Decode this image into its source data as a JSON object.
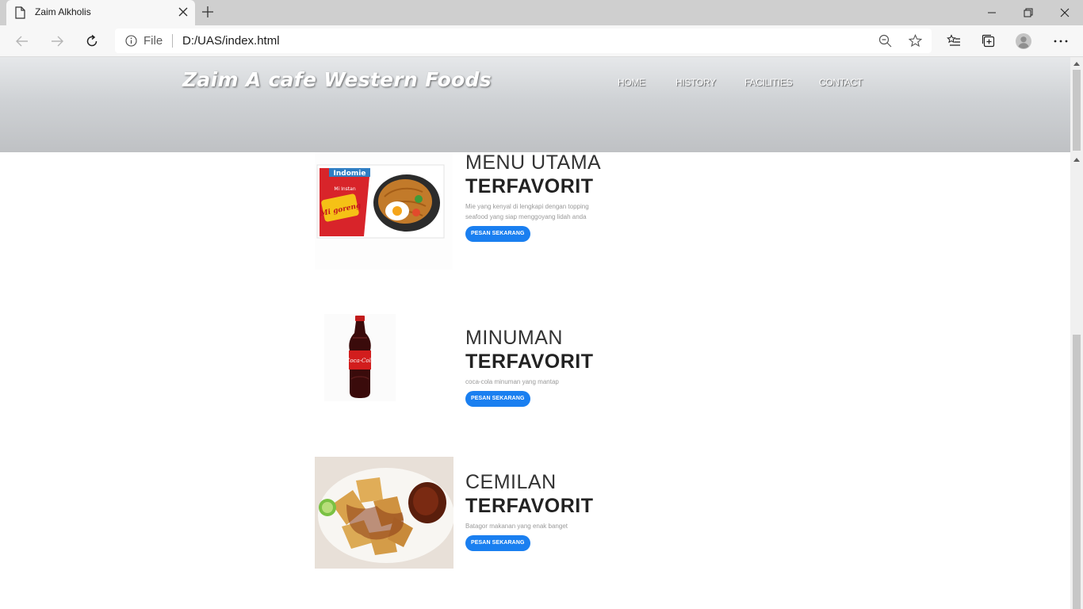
{
  "browser": {
    "tab_title": "Zaim Alkholis",
    "address_scheme": "File",
    "url": "D:/UAS/index.html"
  },
  "site": {
    "title": "Zaim A cafe Western Foods",
    "nav": [
      "HOME",
      "HISTORY",
      "FACILITIES",
      "CONTACT"
    ]
  },
  "menu": [
    {
      "category": "MENU UTAMA",
      "highlight": "TERFAVORIT",
      "description": "Mie yang kenyal di lengkapi dengan topping seafood yang siap menggoyang lidah anda",
      "button": "PESAN SEKARANG",
      "image": "indomie-mi-goreng-image",
      "packet_brand": "Indomie",
      "packet_sub": "Mi Instan",
      "packet_name": "Mi goreng"
    },
    {
      "category": "MINUMAN",
      "highlight": "TERFAVORIT",
      "description": "coca-cola minuman yang mantap",
      "button": "PESAN SEKARANG",
      "image": "coca-cola-bottle-image",
      "bottle_label": "Coca-Cola"
    },
    {
      "category": "CEMILAN",
      "highlight": "TERFAVORIT",
      "description": "Batagor makanan yang enak banget",
      "button": "PESAN SEKARANG",
      "image": "batagor-plate-image"
    }
  ],
  "colors": {
    "accent_button": "#1a7ff0",
    "header_gradient_top": "#e6e8ea",
    "header_gradient_bottom": "#bfc1c4"
  }
}
